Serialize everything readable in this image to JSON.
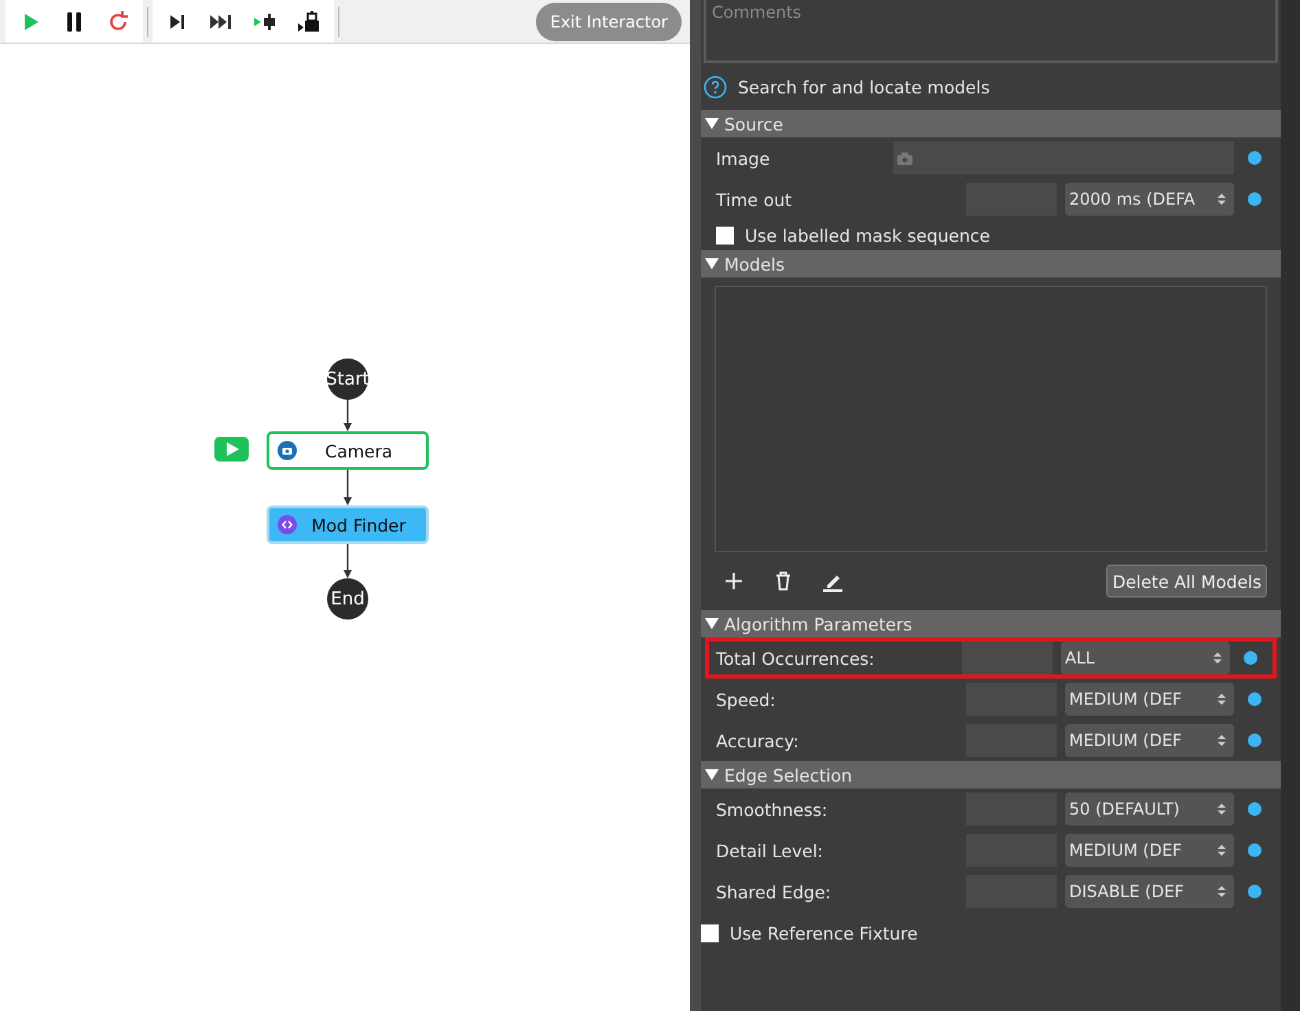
{
  "toolbar": {
    "buttons": [
      {
        "kind": "run"
      },
      {
        "kind": "pause"
      },
      {
        "kind": "restart"
      },
      {
        "kind": "step"
      },
      {
        "kind": "fast"
      },
      {
        "kind": "run-to"
      },
      {
        "kind": "breakpoint"
      }
    ],
    "exit_button": "Exit Interactor"
  },
  "flow": {
    "nodes": [
      {
        "kind": "terminal",
        "label": "Start"
      },
      {
        "kind": "camera",
        "label": "Camera",
        "current": true,
        "selected": false
      },
      {
        "kind": "finder",
        "label": "Mod Finder",
        "current": false,
        "selected": true
      },
      {
        "kind": "terminal",
        "label": "End"
      }
    ]
  },
  "panel": {
    "comments": {
      "placeholder": "Comments"
    },
    "help": "Search for and locate models",
    "sections": [
      {
        "title": "Source",
        "expanded": true,
        "rows": [
          {
            "kind": "image",
            "label": "Image"
          },
          {
            "kind": "select",
            "label": "Time out",
            "value": "2000 ms (DEFA",
            "highlighted": false
          },
          {
            "kind": "checkbox",
            "label": "Use labelled mask sequence",
            "checked": false
          }
        ]
      },
      {
        "title": "Models",
        "expanded": true,
        "rows": [
          {
            "kind": "models",
            "button": "Delete All Models"
          }
        ]
      },
      {
        "title": "Algorithm Parameters",
        "expanded": true,
        "rows": [
          {
            "kind": "select",
            "label": "Total Occurrences:",
            "value": "ALL",
            "highlighted": true
          },
          {
            "kind": "select",
            "label": "Speed:",
            "value": "MEDIUM (DEF",
            "highlighted": false
          },
          {
            "kind": "select",
            "label": "Accuracy:",
            "value": "MEDIUM (DEF",
            "highlighted": false
          }
        ]
      },
      {
        "title": "Edge Selection",
        "expanded": true,
        "rows": [
          {
            "kind": "select",
            "label": "Smoothness:",
            "value": "50 (DEFAULT)",
            "highlighted": false
          },
          {
            "kind": "select",
            "label": "Detail Level:",
            "value": "MEDIUM (DEF",
            "highlighted": false
          },
          {
            "kind": "select",
            "label": "Shared Edge:",
            "value": "DISABLE (DEF",
            "highlighted": false
          }
        ]
      }
    ],
    "fixture": {
      "label": "Use Reference Fixture",
      "checked": false
    }
  }
}
